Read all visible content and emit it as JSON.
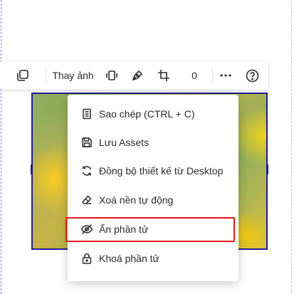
{
  "toolbar": {
    "duplicate_icon": "copy-icon",
    "replace_image_label": "Thay ảnh",
    "flip_icon": "flip-icon",
    "pen_icon": "pen-icon",
    "crop_icon": "crop-icon",
    "rotation_value": "0",
    "more_icon": "more-horizontal-icon",
    "help_icon": "help-circle-icon"
  },
  "menu": {
    "items": [
      {
        "label": "Sao chép (CTRL + C)",
        "icon": "document-copy-icon"
      },
      {
        "label": "Lưu Assets",
        "icon": "save-icon"
      },
      {
        "label": "Đồng bộ thiết kế từ Desktop",
        "icon": "sync-icon"
      },
      {
        "label": "Xoá nền tự động",
        "icon": "eraser-icon"
      },
      {
        "label": "Ẩn phần tử",
        "icon": "eye-off-icon"
      },
      {
        "label": "Khoá phần tử",
        "icon": "lock-icon"
      }
    ]
  },
  "colors": {
    "selection": "#1f1f8f",
    "highlight": "#e01b1b"
  }
}
